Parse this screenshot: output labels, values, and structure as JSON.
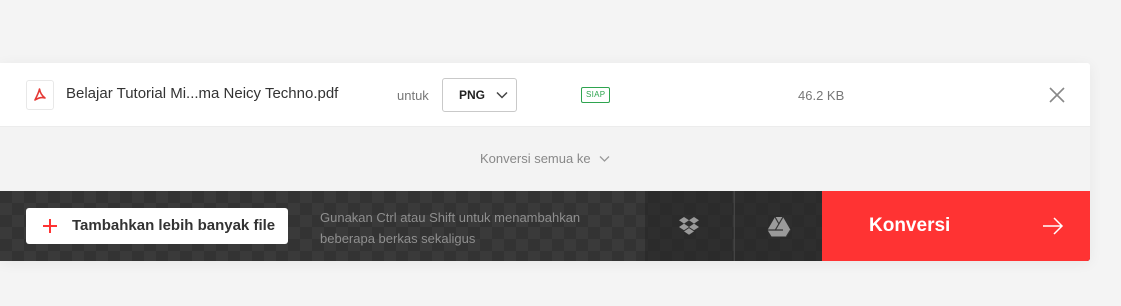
{
  "file": {
    "icon": "pdf-icon",
    "name": "Belajar Tutorial Mi...ma Neicy Techno.pdf",
    "to_label": "untuk",
    "format": "PNG",
    "status": "SIAP",
    "size": "46.2 KB",
    "remove_icon": "close-icon"
  },
  "convert_all": {
    "label": "Konversi semua ke",
    "icon": "chevron-down-icon"
  },
  "toolbar": {
    "add_label": "Tambahkan lebih banyak file",
    "hint_line1": "Gunakan Ctrl atau Shift untuk menambahkan",
    "hint_line2": "beberapa berkas sekaligus",
    "dropbox_icon": "dropbox-icon",
    "drive_icon": "google-drive-icon",
    "convert_label": "Konversi",
    "convert_icon": "arrow-right-icon"
  },
  "colors": {
    "accent": "#ff3333",
    "status": "#2ea44f",
    "toolbar": "#333333"
  }
}
